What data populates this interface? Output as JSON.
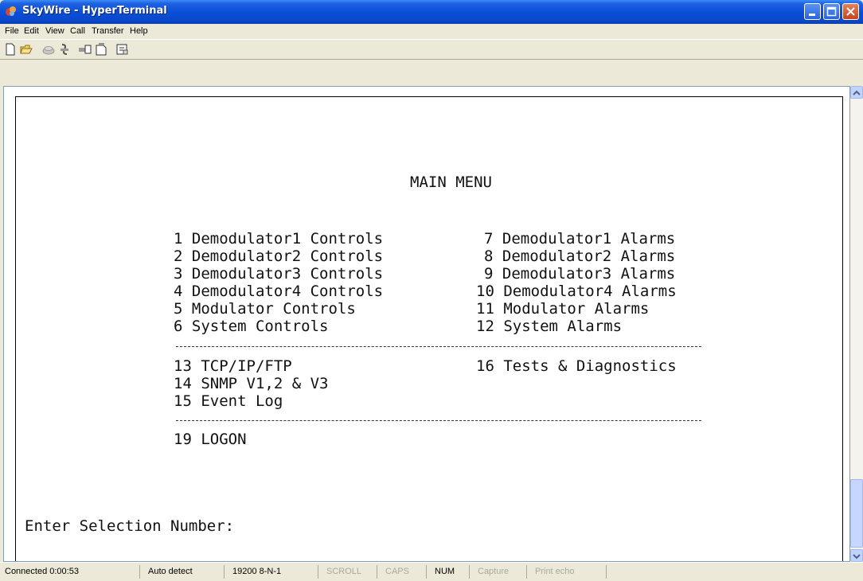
{
  "window": {
    "title": "SkyWire - HyperTerminal",
    "app_icon": "hyperterminal-icon"
  },
  "menubar": {
    "items": [
      "File",
      "Edit",
      "View",
      "Call",
      "Transfer",
      "Help"
    ]
  },
  "toolbar": {
    "icons": [
      "new-icon",
      "open-icon",
      "connect-icon",
      "disconnect-icon",
      "send-icon",
      "receive-icon",
      "properties-icon"
    ]
  },
  "terminal": {
    "heading": "MAIN MENU",
    "left_items": [
      "1 Demodulator1 Controls",
      "2 Demodulator2 Controls",
      "3 Demodulator3 Controls",
      "4 Demodulator4 Controls",
      "5 Modulator Controls",
      "6 System Controls"
    ],
    "right_items": [
      "7 Demodulator1 Alarms",
      "8 Demodulator2 Alarms",
      "9 Demodulator3 Alarms",
      "10 Demodulator4 Alarms",
      "11 Modulator Alarms",
      "12 System Alarms"
    ],
    "net_items": [
      "13 TCP/IP/FTP",
      "14 SNMP V1,2 & V3",
      "15 Event Log"
    ],
    "diag_item": "16 Tests & Diagnostics",
    "logon_item": "19 LOGON",
    "prompt": "Enter Selection Number:"
  },
  "statusbar": {
    "connected": "Connected 0:00:53",
    "detect": "Auto detect",
    "settings": "19200 8-N-1",
    "scroll": "SCROLL",
    "caps": "CAPS",
    "num": "NUM",
    "capture": "Capture",
    "print_echo": "Print echo"
  },
  "colors": {
    "titlebar": "#0A4FD8",
    "chrome": "#ECE9D8",
    "terminal_bg": "#FFFFFF"
  }
}
